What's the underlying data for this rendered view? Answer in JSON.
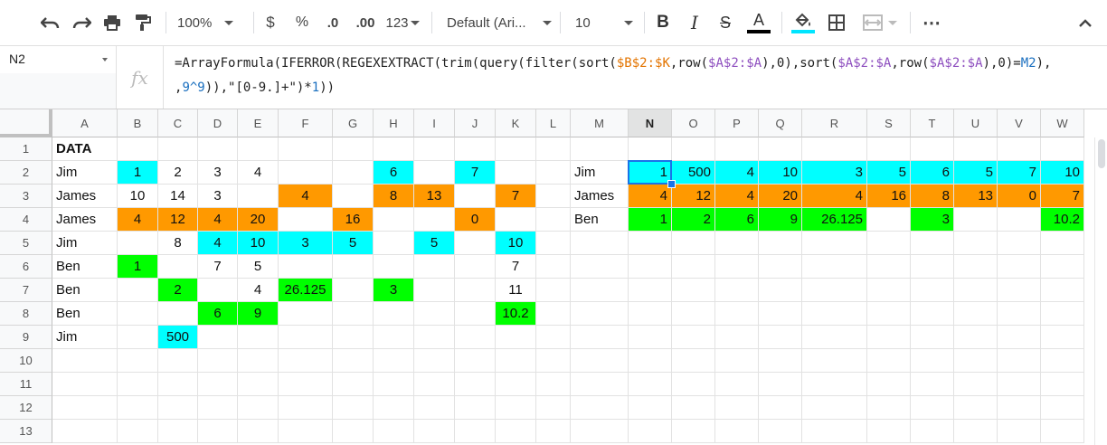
{
  "toolbar": {
    "zoom": "100%",
    "currency": "$",
    "percent": "%",
    "decrease_decimals": ".0",
    "increase_decimals": ".00",
    "more_formats": "123",
    "font_family": "Default (Ari...",
    "font_size": "10",
    "bold": "B",
    "italic": "I",
    "strikethrough": "S",
    "text_color_letter": "A",
    "text_color": "#000000",
    "fill_color": "#00e5ff",
    "more": "⋯"
  },
  "formula_bar": {
    "cell_ref": "N2",
    "fx": "fx",
    "formula_parts": [
      {
        "text": "=ArrayFormula(IFERROR(REGEXEXTRACT(trim(query(filter(sort(",
        "color": "default"
      },
      {
        "text": "$B$2:$K",
        "color": "orange"
      },
      {
        "text": ",row(",
        "color": "default"
      },
      {
        "text": "$A$2:$A",
        "color": "purple"
      },
      {
        "text": "),0),sort(",
        "color": "default"
      },
      {
        "text": "$A$2:$A",
        "color": "purple"
      },
      {
        "text": ",row(",
        "color": "default"
      },
      {
        "text": "$A$2:$A",
        "color": "purple"
      },
      {
        "text": "),0)=",
        "color": "default"
      },
      {
        "text": "M2",
        "color": "blue"
      },
      {
        "text": "),\n,",
        "color": "default"
      },
      {
        "text": "9^9",
        "color": "blue"
      },
      {
        "text": ")),\"[0-9.]+\")*",
        "color": "default"
      },
      {
        "text": "1",
        "color": "blue"
      },
      {
        "text": "))",
        "color": "default"
      }
    ]
  },
  "columns": [
    "A",
    "B",
    "C",
    "D",
    "E",
    "F",
    "G",
    "H",
    "I",
    "J",
    "K",
    "L",
    "M",
    "N",
    "O",
    "P",
    "Q",
    "R",
    "S",
    "T",
    "U",
    "V",
    "W"
  ],
  "selected_column": "N",
  "rows": [
    "1",
    "2",
    "3",
    "4",
    "5",
    "6",
    "7",
    "8",
    "9",
    "10",
    "11",
    "12",
    "13"
  ],
  "colors": {
    "cyan": "#00ffff",
    "orange": "#ff9900",
    "green": "#00ff00",
    "selection": "#1a73e8"
  },
  "cells": [
    {
      "ref": "A1",
      "v": "DATA",
      "bold": true,
      "align": "l"
    },
    {
      "ref": "A2",
      "v": "Jim",
      "align": "l"
    },
    {
      "ref": "B2",
      "v": "1",
      "fill": "cyan",
      "align": "c"
    },
    {
      "ref": "C2",
      "v": "2",
      "align": "c"
    },
    {
      "ref": "D2",
      "v": "3",
      "align": "c"
    },
    {
      "ref": "E2",
      "v": "4",
      "align": "c"
    },
    {
      "ref": "H2",
      "v": "6",
      "fill": "cyan",
      "align": "c"
    },
    {
      "ref": "J2",
      "v": "7",
      "fill": "cyan",
      "align": "c"
    },
    {
      "ref": "A3",
      "v": "James",
      "align": "l"
    },
    {
      "ref": "B3",
      "v": "10",
      "align": "c"
    },
    {
      "ref": "C3",
      "v": "14",
      "align": "c"
    },
    {
      "ref": "D3",
      "v": "3",
      "align": "c"
    },
    {
      "ref": "F3",
      "v": "4",
      "fill": "orange",
      "align": "c"
    },
    {
      "ref": "H3",
      "v": "8",
      "fill": "orange",
      "align": "c"
    },
    {
      "ref": "I3",
      "v": "13",
      "fill": "orange",
      "align": "c"
    },
    {
      "ref": "K3",
      "v": "7",
      "fill": "orange",
      "align": "c"
    },
    {
      "ref": "A4",
      "v": "James",
      "align": "l"
    },
    {
      "ref": "B4",
      "v": "4",
      "fill": "orange",
      "align": "c"
    },
    {
      "ref": "C4",
      "v": "12",
      "fill": "orange",
      "align": "c"
    },
    {
      "ref": "D4",
      "v": "4",
      "fill": "orange",
      "align": "c"
    },
    {
      "ref": "E4",
      "v": "20",
      "fill": "orange",
      "align": "c"
    },
    {
      "ref": "G4",
      "v": "16",
      "fill": "orange",
      "align": "c"
    },
    {
      "ref": "J4",
      "v": "0",
      "fill": "orange",
      "align": "c"
    },
    {
      "ref": "A5",
      "v": "Jim",
      "align": "l"
    },
    {
      "ref": "C5",
      "v": "8",
      "align": "c"
    },
    {
      "ref": "D5",
      "v": "4",
      "fill": "cyan",
      "align": "c"
    },
    {
      "ref": "E5",
      "v": "10",
      "fill": "cyan",
      "align": "c"
    },
    {
      "ref": "F5",
      "v": "3",
      "fill": "cyan",
      "align": "c"
    },
    {
      "ref": "G5",
      "v": "5",
      "fill": "cyan",
      "align": "c"
    },
    {
      "ref": "I5",
      "v": "5",
      "fill": "cyan",
      "align": "c"
    },
    {
      "ref": "K5",
      "v": "10",
      "fill": "cyan",
      "align": "c"
    },
    {
      "ref": "A6",
      "v": "Ben",
      "align": "l"
    },
    {
      "ref": "B6",
      "v": "1",
      "fill": "green",
      "align": "c"
    },
    {
      "ref": "D6",
      "v": "7",
      "align": "c"
    },
    {
      "ref": "E6",
      "v": "5",
      "align": "c"
    },
    {
      "ref": "K6",
      "v": "7",
      "align": "c"
    },
    {
      "ref": "A7",
      "v": "Ben",
      "align": "l"
    },
    {
      "ref": "C7",
      "v": "2",
      "fill": "green",
      "align": "c"
    },
    {
      "ref": "E7",
      "v": "4",
      "align": "c"
    },
    {
      "ref": "F7",
      "v": "26.125",
      "fill": "green",
      "align": "c"
    },
    {
      "ref": "H7",
      "v": "3",
      "fill": "green",
      "align": "c"
    },
    {
      "ref": "K7",
      "v": "11",
      "align": "c"
    },
    {
      "ref": "A8",
      "v": "Ben",
      "align": "l"
    },
    {
      "ref": "D8",
      "v": "6",
      "fill": "green",
      "align": "c"
    },
    {
      "ref": "E8",
      "v": "9",
      "fill": "green",
      "align": "c"
    },
    {
      "ref": "K8",
      "v": "10.2",
      "fill": "green",
      "align": "c"
    },
    {
      "ref": "A9",
      "v": "Jim",
      "align": "l"
    },
    {
      "ref": "C9",
      "v": "500",
      "fill": "cyan",
      "align": "c"
    },
    {
      "ref": "M2",
      "v": "Jim",
      "align": "l"
    },
    {
      "ref": "N2",
      "v": "1",
      "fill": "cyan",
      "align": "r"
    },
    {
      "ref": "O2",
      "v": "500",
      "fill": "cyan",
      "align": "r"
    },
    {
      "ref": "P2",
      "v": "4",
      "fill": "cyan",
      "align": "r"
    },
    {
      "ref": "Q2",
      "v": "10",
      "fill": "cyan",
      "align": "r"
    },
    {
      "ref": "R2",
      "v": "3",
      "fill": "cyan",
      "align": "r"
    },
    {
      "ref": "S2",
      "v": "5",
      "fill": "cyan",
      "align": "r"
    },
    {
      "ref": "T2",
      "v": "6",
      "fill": "cyan",
      "align": "r"
    },
    {
      "ref": "U2",
      "v": "5",
      "fill": "cyan",
      "align": "r"
    },
    {
      "ref": "V2",
      "v": "7",
      "fill": "cyan",
      "align": "r"
    },
    {
      "ref": "W2",
      "v": "10",
      "fill": "cyan",
      "align": "r"
    },
    {
      "ref": "M3",
      "v": "James",
      "align": "l"
    },
    {
      "ref": "N3",
      "v": "4",
      "fill": "orange",
      "align": "r"
    },
    {
      "ref": "O3",
      "v": "12",
      "fill": "orange",
      "align": "r"
    },
    {
      "ref": "P3",
      "v": "4",
      "fill": "orange",
      "align": "r"
    },
    {
      "ref": "Q3",
      "v": "20",
      "fill": "orange",
      "align": "r"
    },
    {
      "ref": "R3",
      "v": "4",
      "fill": "orange",
      "align": "r"
    },
    {
      "ref": "S3",
      "v": "16",
      "fill": "orange",
      "align": "r"
    },
    {
      "ref": "T3",
      "v": "8",
      "fill": "orange",
      "align": "r"
    },
    {
      "ref": "U3",
      "v": "13",
      "fill": "orange",
      "align": "r"
    },
    {
      "ref": "V3",
      "v": "0",
      "fill": "orange",
      "align": "r"
    },
    {
      "ref": "W3",
      "v": "7",
      "fill": "orange",
      "align": "r"
    },
    {
      "ref": "M4",
      "v": "Ben",
      "align": "l"
    },
    {
      "ref": "N4",
      "v": "1",
      "fill": "green",
      "align": "r"
    },
    {
      "ref": "O4",
      "v": "2",
      "fill": "green",
      "align": "r"
    },
    {
      "ref": "P4",
      "v": "6",
      "fill": "green",
      "align": "r"
    },
    {
      "ref": "Q4",
      "v": "9",
      "fill": "green",
      "align": "r"
    },
    {
      "ref": "R4",
      "v": "26.125",
      "fill": "green",
      "align": "r"
    },
    {
      "ref": "T4",
      "v": "3",
      "fill": "green",
      "align": "r"
    },
    {
      "ref": "W4",
      "v": "10.2",
      "fill": "green",
      "align": "r"
    }
  ]
}
